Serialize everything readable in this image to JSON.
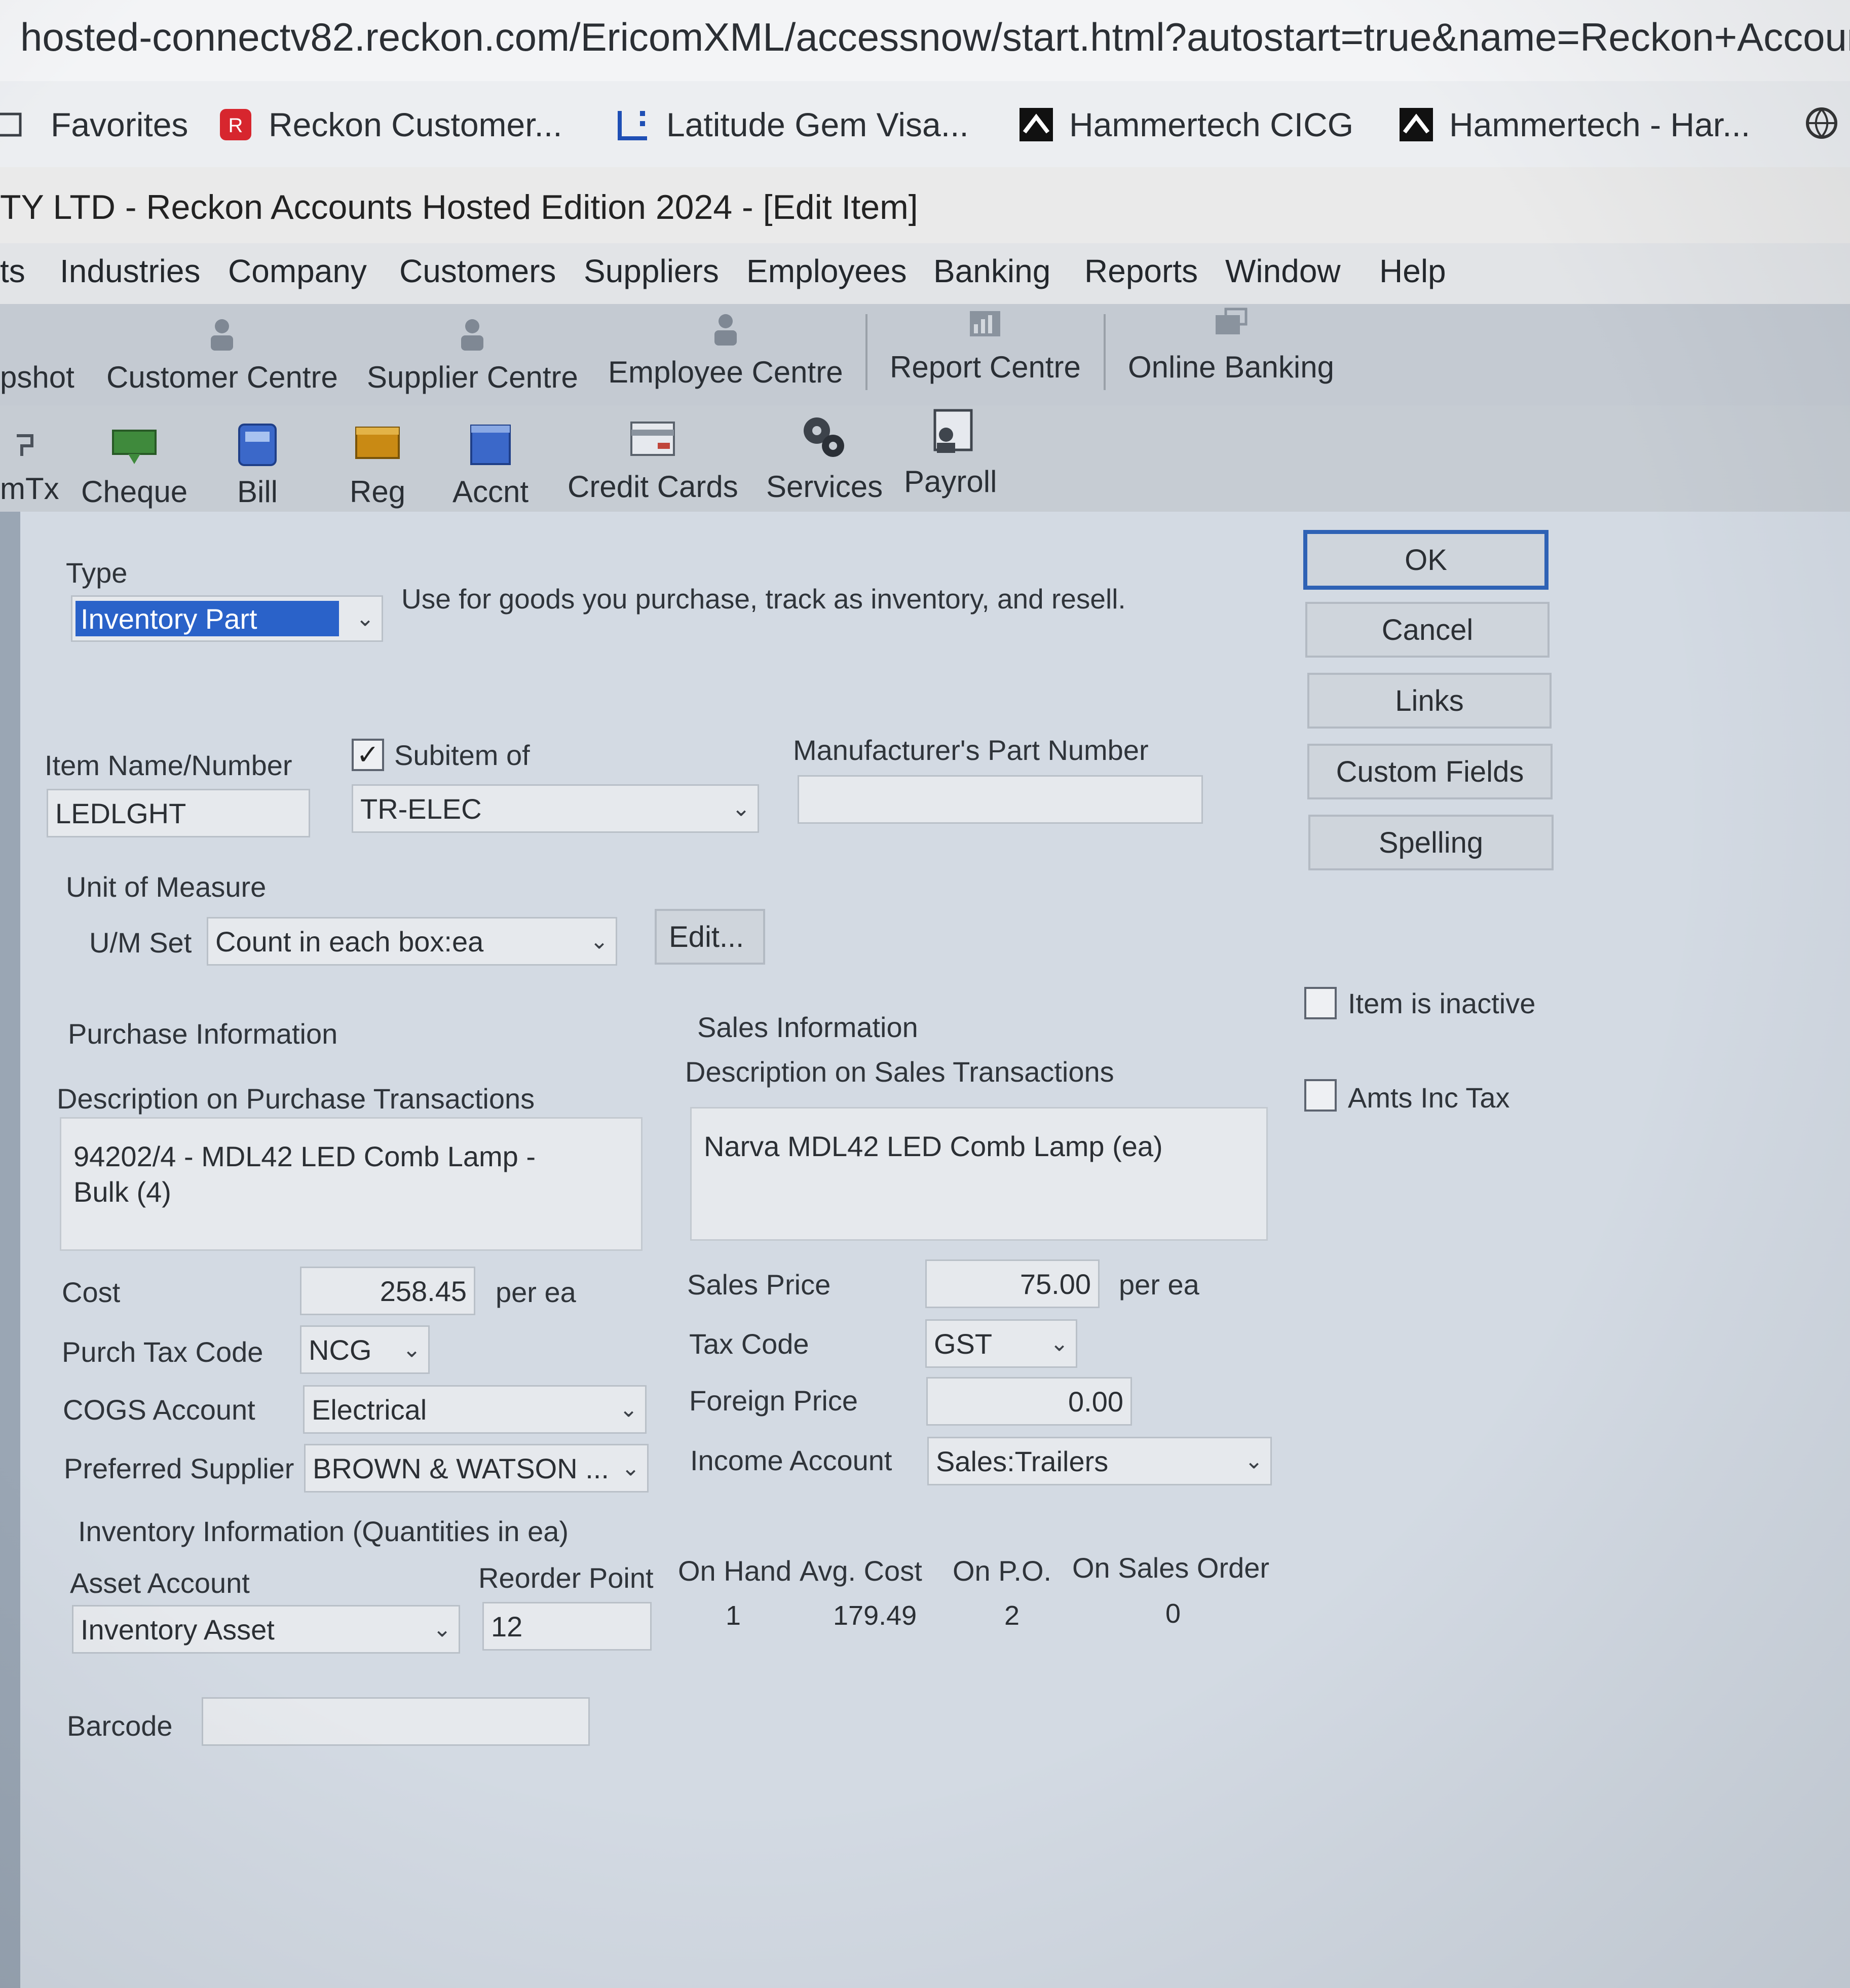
{
  "browser": {
    "address": "hosted-connectv82.reckon.com/EricomXML/accessnow/start.html?autostart=true&name=Reckon+Accoun"
  },
  "favorites": [
    {
      "label": "Favorites",
      "icon": "folder-icon"
    },
    {
      "label": "Reckon Customer...",
      "icon": "reckon-logo-icon"
    },
    {
      "label": "Latitude Gem Visa...",
      "icon": "latitude-logo-icon"
    },
    {
      "label": "Hammertech CICG",
      "icon": "hammertech-logo-icon"
    },
    {
      "label": "Hammertech - Har...",
      "icon": "hammertech-logo-icon"
    }
  ],
  "app": {
    "title": "TY LTD - Reckon Accounts Hosted Edition 2024 - [Edit Item]"
  },
  "menu": [
    "ts",
    "Industries",
    "Company",
    "Customers",
    "Suppliers",
    "Employees",
    "Banking",
    "Reports",
    "Window",
    "Help"
  ],
  "toolbar1": [
    {
      "label": "pshot",
      "icon": "snapshot-icon"
    },
    {
      "label": "Customer Centre",
      "icon": "customer-centre-icon"
    },
    {
      "label": "Supplier Centre",
      "icon": "supplier-centre-icon"
    },
    {
      "label": "Employee Centre",
      "icon": "employee-centre-icon"
    },
    {
      "label": "Report Centre",
      "icon": "report-centre-icon"
    },
    {
      "label": "Online Banking",
      "icon": "online-banking-icon"
    }
  ],
  "toolbar2": [
    {
      "label": "mTx",
      "icon": "memtx-icon"
    },
    {
      "label": "Cheque",
      "icon": "cheque-icon"
    },
    {
      "label": "Bill",
      "icon": "bill-icon"
    },
    {
      "label": "Reg",
      "icon": "register-icon"
    },
    {
      "label": "Accnt",
      "icon": "account-icon"
    },
    {
      "label": "Credit Cards",
      "icon": "credit-card-icon"
    },
    {
      "label": "Services",
      "icon": "services-icon"
    },
    {
      "label": "Payroll",
      "icon": "payroll-icon"
    }
  ],
  "dialog": {
    "type_label": "Type",
    "type_value": "Inventory Part",
    "type_help": "Use for goods you purchase, track as inventory, and resell.",
    "item_name_label": "Item Name/Number",
    "item_name_value": "LEDLGHT",
    "subitem_label": "Subitem of",
    "subitem_checked": true,
    "subitem_value": "TR-ELEC",
    "mfr_label": "Manufacturer's Part Number",
    "mfr_value": "",
    "uom_label": "Unit of Measure",
    "um_set_label": "U/M Set",
    "um_set_value": "Count in each box:ea",
    "edit_button": "Edit...",
    "purchase_heading": "Purchase Information",
    "purchase_desc_label": "Description on Purchase Transactions",
    "purchase_desc": "94202/4 - MDL42 LED Comb Lamp -\nBulk (4)",
    "sales_heading": "Sales Information",
    "sales_desc_label": "Description on Sales Transactions",
    "sales_desc": "Narva MDL42 LED Comb Lamp (ea)",
    "cost_label": "Cost",
    "cost_value": "258.45",
    "cost_unit": "per ea",
    "purch_tax_label": "Purch Tax Code",
    "purch_tax_value": "NCG",
    "cogs_label": "COGS Account",
    "cogs_value": "Electrical",
    "pref_supplier_label": "Preferred Supplier",
    "pref_supplier_value": "BROWN & WATSON ...",
    "sales_price_label": "Sales Price",
    "sales_price_value": "75.00",
    "sales_price_unit": "per ea",
    "tax_code_label": "Tax Code",
    "tax_code_value": "GST",
    "foreign_price_label": "Foreign Price",
    "foreign_price_value": "0.00",
    "income_label": "Income Account",
    "income_value": "Sales:Trailers",
    "inventory_heading": "Inventory Information (Quantities in ea)",
    "asset_label": "Asset Account",
    "asset_value": "Inventory Asset",
    "reorder_label": "Reorder Point",
    "reorder_value": "12",
    "on_hand_label": "On Hand",
    "on_hand_value": "1",
    "avg_cost_label": "Avg. Cost",
    "avg_cost_value": "179.49",
    "on_po_label": "On P.O.",
    "on_po_value": "2",
    "on_so_label": "On Sales Order",
    "on_so_value": "0",
    "barcode_label": "Barcode",
    "barcode_value": "",
    "buttons": {
      "ok": "OK",
      "cancel": "Cancel",
      "links": "Links",
      "custom_fields": "Custom Fields",
      "spelling": "Spelling"
    },
    "inactive_label": "Item is inactive",
    "inactive_checked": false,
    "amts_inc_tax_label": "Amts Inc Tax",
    "amts_inc_tax_checked": false
  },
  "colors": {
    "ok_border": "#2f62b5",
    "selection": "#2a62c9",
    "reckon_red": "#d7262e"
  }
}
